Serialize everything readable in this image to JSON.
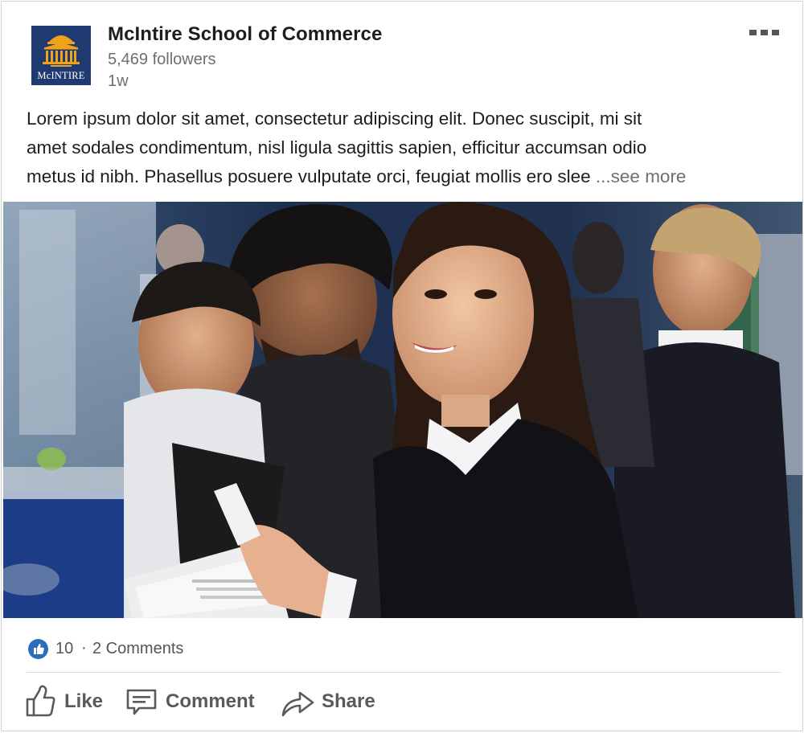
{
  "post": {
    "author": {
      "name": "McIntire School of Commerce",
      "followers": "5,469 followers",
      "timestamp": "1w",
      "logo": {
        "text": "McINTIRE",
        "icon": "rotunda-logo-icon",
        "background": "#1f3a70",
        "accent": "#f0a21b"
      }
    },
    "menu_icon": "more-horizontal-icon",
    "text_lines": [
      "Lorem ipsum dolor sit amet, consectetur adipiscing elit. Donec suscipit, mi sit",
      "amet sodales condimentum, nisl ligula sagittis sapien, efficitur accumsan odio",
      "metus id nibh. Phasellus posuere vulputate orci, feugiat mollis ero slee"
    ],
    "see_more": "...see more",
    "image": {
      "icon": "post-photo",
      "subject": "career fair photo"
    }
  },
  "social": {
    "reaction_icon": "like-reaction-icon",
    "like_count": "10",
    "separator": "·",
    "comments": "2 Comments"
  },
  "actions": [
    {
      "label": "Like",
      "icon": "thumbs-up-icon"
    },
    {
      "label": "Comment",
      "icon": "comment-icon"
    },
    {
      "label": "Share",
      "icon": "share-arrow-icon"
    }
  ],
  "colors": {
    "text": "#1d1d1d",
    "muted": "#6f6f6f",
    "action": "#5a5a5a",
    "reaction_blue": "#2a6ebb"
  }
}
